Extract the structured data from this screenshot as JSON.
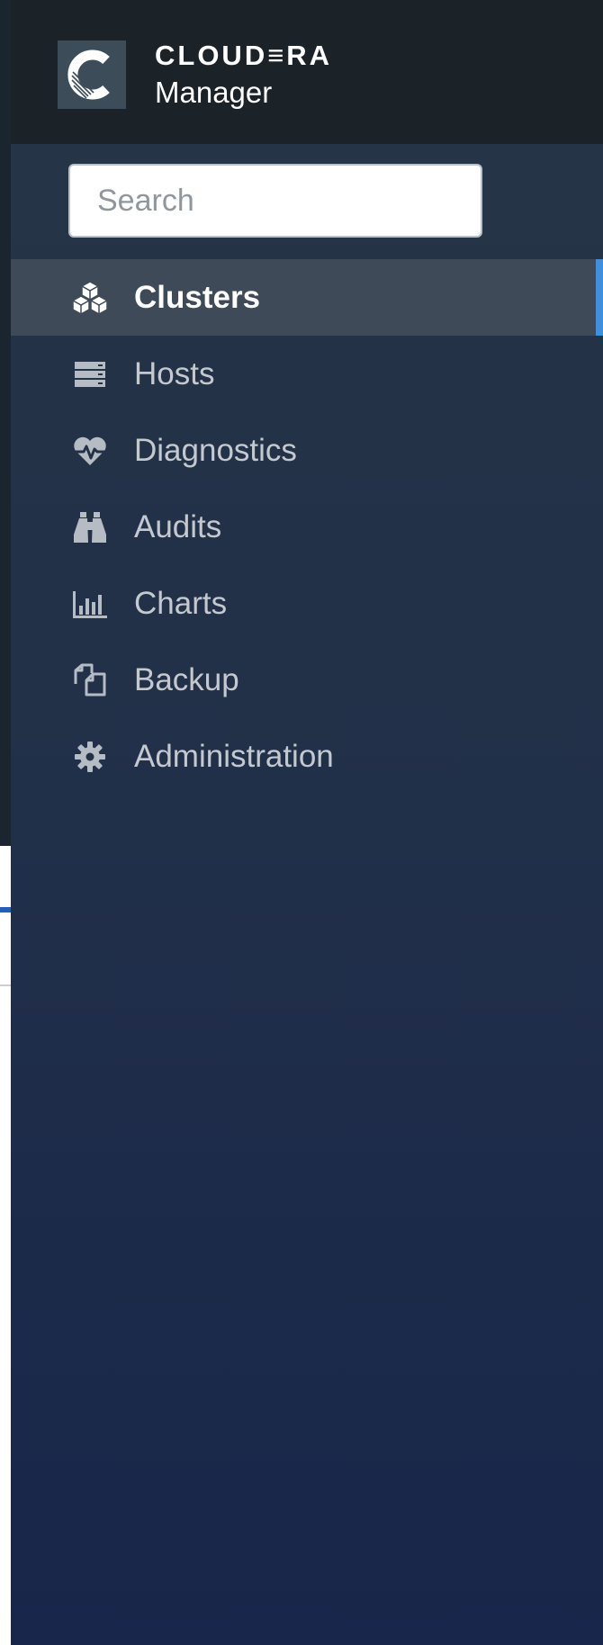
{
  "brand": {
    "name": "CLOUD≡RA",
    "product": "Manager"
  },
  "search": {
    "placeholder": "Search",
    "value": ""
  },
  "nav": {
    "items": [
      {
        "label": "Clusters",
        "icon": "cubes-icon",
        "active": true
      },
      {
        "label": "Hosts",
        "icon": "server-icon",
        "active": false
      },
      {
        "label": "Diagnostics",
        "icon": "heartbeat-icon",
        "active": false
      },
      {
        "label": "Audits",
        "icon": "binoculars-icon",
        "active": false
      },
      {
        "label": "Charts",
        "icon": "bar-chart-icon",
        "active": false
      },
      {
        "label": "Backup",
        "icon": "copy-files-icon",
        "active": false
      },
      {
        "label": "Administration",
        "icon": "gear-icon",
        "active": false
      }
    ]
  },
  "colors": {
    "brand_bar": "#1b2228",
    "sidebar_top": "#283648",
    "sidebar_bottom": "#17264a",
    "active_item": "#3e4a58",
    "active_accent": "#3d8fe0",
    "nav_text": "#c4c9cf"
  }
}
